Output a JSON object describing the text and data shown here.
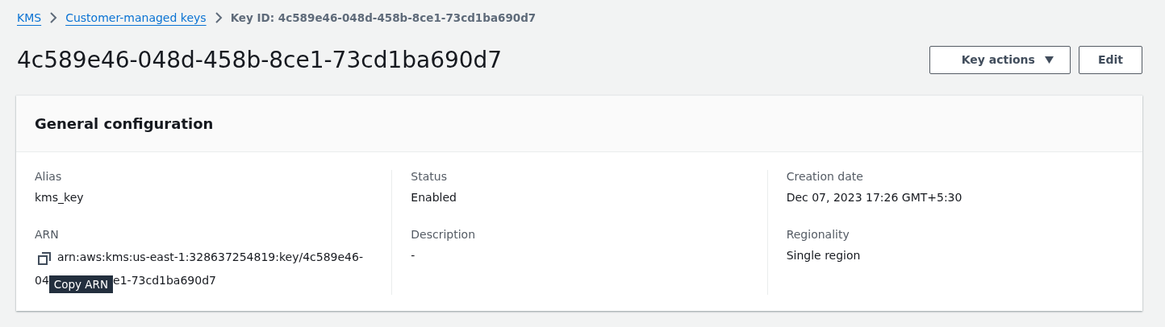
{
  "breadcrumbs": [
    {
      "label": "KMS",
      "kind": "link"
    },
    {
      "label": "Customer-managed keys",
      "kind": "link"
    },
    {
      "label": "Key ID: 4c589e46-048d-458b-8ce1-73cd1ba690d7",
      "kind": "current"
    }
  ],
  "title": "4c589e46-048d-458b-8ce1-73cd1ba690d7",
  "actions": [
    {
      "label": "Key actions",
      "kind": "dropdown"
    },
    {
      "label": "Edit",
      "kind": "button"
    }
  ],
  "panel": {
    "title": "General configuration",
    "columns": [
      [
        {
          "label": "Alias",
          "value": "kms_key"
        },
        {
          "label": "ARN",
          "kind": "arn",
          "line_1": "arn:aws:kms:us-east-1:328637254819:key/4c589e46-",
          "line_2_start": "04",
          "tooltip": "Copy ARN",
          "line_2_end": "e1-73cd1ba690d7"
        }
      ],
      [
        {
          "label": "Status",
          "value": "Enabled"
        },
        {
          "label": "Description",
          "value": "-"
        }
      ],
      [
        {
          "label": "Creation date",
          "value": "Dec 07, 2023 17:26 GMT+5:30"
        },
        {
          "label": "Regionality",
          "value": "Single region"
        }
      ]
    ]
  }
}
